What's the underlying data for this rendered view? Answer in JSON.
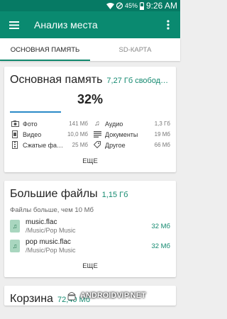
{
  "status_bar": {
    "battery": "45%",
    "time": "9:26 AM"
  },
  "app_bar": {
    "title": "Анализ места"
  },
  "tabs": [
    {
      "label": "ОСНОВНАЯ ПАМЯТЬ"
    },
    {
      "label": "SD-КАРТА"
    }
  ],
  "storage_card": {
    "title": "Основная память",
    "free": "7,27 Гб свобод…",
    "percent": "32%",
    "used_fraction": 0.32,
    "categories": [
      {
        "icon": "photo-icon",
        "label": "Фото",
        "size": "141 Мб"
      },
      {
        "icon": "audio-icon",
        "label": "Аудио",
        "size": "1,3 Гб"
      },
      {
        "icon": "video-icon",
        "label": "Видео",
        "size": "10,0 Мб"
      },
      {
        "icon": "documents-icon",
        "label": "Документы",
        "size": "19 Мб"
      },
      {
        "icon": "compressed-icon",
        "label": "Сжатые фа…",
        "size": "25 Мб"
      },
      {
        "icon": "other-icon",
        "label": "Другое",
        "size": "66 Мб"
      }
    ],
    "more": "ЕЩЕ"
  },
  "large_files_card": {
    "title": "Большие файлы",
    "total": "1,15 Гб",
    "note": "Файлы больше, чем 10 Мб",
    "files": [
      {
        "name": "music.flac",
        "path": "/Music/Pop Music",
        "size": "32 Мб"
      },
      {
        "name": "pop music.flac",
        "path": "/Music/Pop Music",
        "size": "32 Мб"
      }
    ],
    "more": "ЕЩЕ"
  },
  "trash_card": {
    "title": "Корзина",
    "size": "72,40 Мб"
  },
  "watermark": {
    "text": "ANDROIDVIP.NET"
  }
}
